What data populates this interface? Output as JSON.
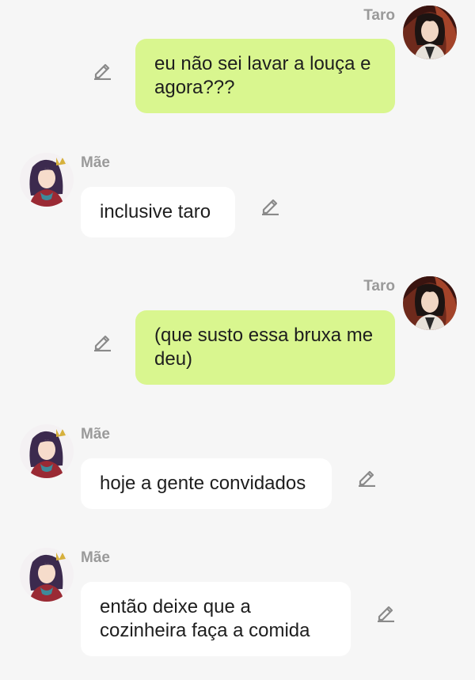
{
  "messages": [
    {
      "sender": "Taro",
      "side": "right",
      "text": "eu não sei lavar a louça e agora???"
    },
    {
      "sender": "Mãe",
      "side": "left",
      "text": "inclusive taro"
    },
    {
      "sender": "Taro",
      "side": "right",
      "text": "(que susto essa bruxa me deu)"
    },
    {
      "sender": "Mãe",
      "side": "left",
      "text": "hoje a gente convidados"
    },
    {
      "sender": "Mãe",
      "side": "left",
      "text": "então deixe que a cozinheira faça a comida"
    }
  ],
  "icons": {
    "edit": "pencil-icon"
  },
  "colors": {
    "my_bubble": "#d9f68f",
    "other_bubble": "#ffffff",
    "background": "#f6f6f6",
    "name": "#9a9a9a"
  }
}
